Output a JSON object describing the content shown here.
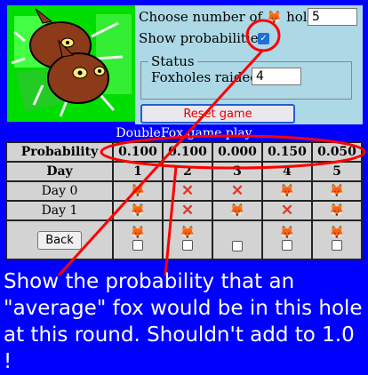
{
  "settings": {
    "choose_prefix": "Choose number of",
    "choose_suffix": "holes:",
    "holes_value": "5",
    "show_prob_label": "Show probabilities",
    "fox_glyph": "🦊"
  },
  "status": {
    "legend": "Status",
    "raided_label": "Foxholes raided:",
    "raided_value": "4"
  },
  "reset_label": "Reset game",
  "caption": "DoubleFox game play",
  "table": {
    "prob_label": "Probability",
    "probabilities": [
      "0.100",
      "0.100",
      "0.000",
      "0.150",
      "0.050"
    ],
    "day_label": "Day",
    "holes": [
      "1",
      "2",
      "3",
      "4",
      "5"
    ],
    "rows": [
      {
        "label": "Day 0",
        "cells": [
          "fox",
          "x",
          "x",
          "fox",
          "fox"
        ]
      },
      {
        "label": "Day 1",
        "cells": [
          "fox",
          "x",
          "fox",
          "x",
          "fox"
        ]
      }
    ],
    "back_label": "Back",
    "icons": {
      "fox": "🦊",
      "x": "✕"
    }
  },
  "annotation": "Show the probability that an \"average\" fox would be in this hole at this round. Shouldn't add to 1.0 !",
  "colors": {
    "background": "#0000ff",
    "panel": "#add8e6",
    "annotation_red": "#ff0000",
    "table_bg": "#d3d3d3"
  }
}
